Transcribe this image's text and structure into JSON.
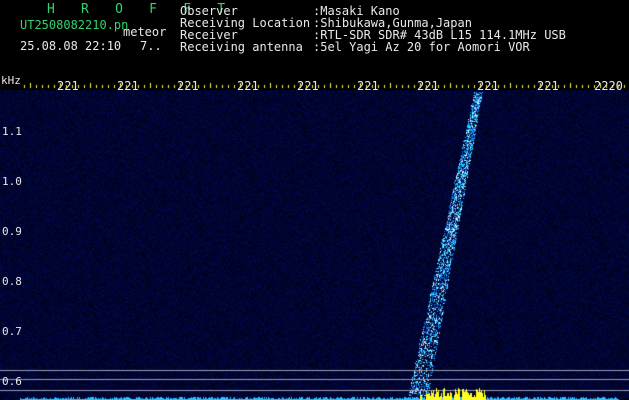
{
  "header": {
    "title": "H R O F F T",
    "file_name": "UT2508082210.pn",
    "meteor_label": "meteor",
    "date_time": "25.08.08 22:10",
    "extra_value": "7..",
    "metadata": [
      {
        "label": "Observer",
        "value": ":Masaki Kano"
      },
      {
        "label": "Receiving Location",
        "value": ":Shibukawa,Gunma,Japan"
      },
      {
        "label": "Receiver",
        "value": ":RTL-SDR SDR# 43dB L15 114.1MHz USB"
      },
      {
        "label": "Receiving antenna",
        "value": ":5el Yagi Az 20 for Aomori VOR"
      }
    ]
  },
  "spectrogram": {
    "y_axis_unit": "kHz",
    "y_ticks": [
      "1.1",
      "1.0",
      "0.9",
      "0.8",
      "0.7",
      "0.6"
    ],
    "x_ticks": [
      "221",
      "221",
      "221",
      "221",
      "221",
      "221",
      "221",
      "221",
      "221",
      "2220"
    ],
    "colors": {
      "title": "#31d36b",
      "text": "#e8e8e8",
      "ticks": "#ffff38",
      "noise": "#0a0a4a",
      "echo": "#20c8ff",
      "baseline": "#ffff20"
    }
  }
}
